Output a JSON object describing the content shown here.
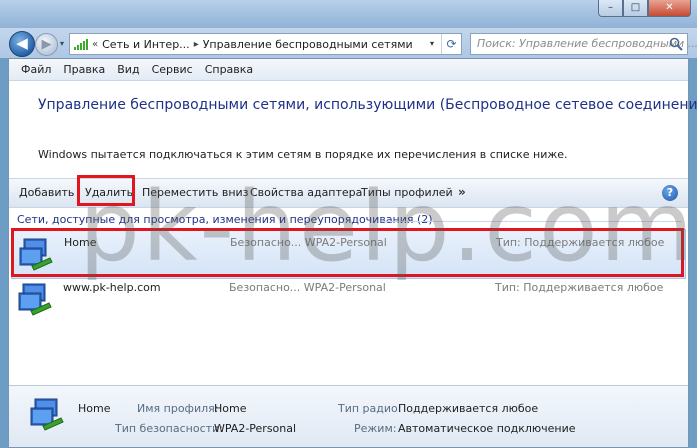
{
  "window": {
    "minimize": "–",
    "maximize": "□",
    "close": "✕"
  },
  "nav": {
    "back": "◀",
    "forward": "▶",
    "recent": "▾",
    "address_sep": "«",
    "address_part1": "Сеть и Интер...",
    "address_arrow": "▸",
    "address_part2": "Управление беспроводными сетями",
    "address_dropdown": "▾",
    "refresh": "⟳",
    "search_placeholder": "Поиск: Управление беспроводными ..."
  },
  "menu": {
    "items": [
      {
        "label": "Файл"
      },
      {
        "label": "Правка"
      },
      {
        "label": "Вид"
      },
      {
        "label": "Сервис"
      },
      {
        "label": "Справка"
      }
    ]
  },
  "header": {
    "title": "Управление беспроводными сетями, использующими (Беспроводное сетевое соединение)",
    "description": "Windows пытается подключаться к этим сетям в порядке их перечисления в списке ниже."
  },
  "toolbar": {
    "add": "Добавить",
    "delete": "Удалить",
    "move_down": "Переместить вниз",
    "adapter_props": "Свойства адаптера",
    "profile_types": "Типы профилей",
    "more": "»",
    "help": "?"
  },
  "group": {
    "header": "Сети, доступные для просмотра, изменения и переупорядочивания (2)"
  },
  "networks": [
    {
      "name": "Home",
      "security": "Безопасно...  WPA2-Personal",
      "type": "Тип: Поддерживается любое"
    },
    {
      "name": "www.pk-help.com",
      "security": "Безопасно...  WPA2-Personal",
      "type": "Тип: Поддерживается любое"
    }
  ],
  "watermark": "pk-help.com",
  "details": {
    "name": "Home",
    "profile_label": "Имя профиля:",
    "profile_value": "Home",
    "security_label": "Тип безопасности:",
    "security_value": "WPA2-Personal",
    "radio_label": "Тип радио:",
    "radio_value": "Поддерживается любое",
    "mode_label": "Режим:",
    "mode_value": "Автоматическое подключение"
  },
  "colors": {
    "highlight_red": "#e0151d",
    "title_blue": "#1e3287"
  }
}
